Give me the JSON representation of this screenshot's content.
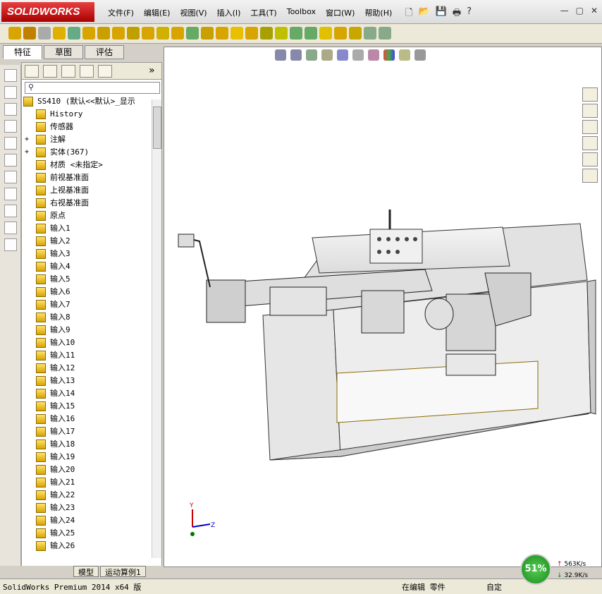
{
  "app": {
    "logo": "SOLIDWORKS"
  },
  "menu": [
    "文件(F)",
    "编辑(E)",
    "视图(V)",
    "插入(I)",
    "工具(T)",
    "Toolbox",
    "窗口(W)",
    "帮助(H)"
  ],
  "fm_tabs": [
    "特征",
    "草图",
    "评估"
  ],
  "tree": {
    "root": "SS410  (默认<<默认>_显示",
    "items": [
      "History",
      "传感器",
      "注解",
      "实体(367)",
      "材质 <未指定>",
      "前视基准面",
      "上视基准面",
      "右视基准面",
      "原点"
    ],
    "inputs": [
      "输入1",
      "输入2",
      "输入3",
      "输入4",
      "输入5",
      "输入6",
      "输入7",
      "输入8",
      "输入9",
      "输入10",
      "输入11",
      "输入12",
      "输入13",
      "输入14",
      "输入15",
      "输入16",
      "输入17",
      "输入18",
      "输入19",
      "输入20",
      "输入21",
      "输入22",
      "输入23",
      "输入24",
      "输入25",
      "输入26"
    ]
  },
  "bottom_tabs": [
    "模型",
    "运动算例1"
  ],
  "status": {
    "left": "SolidWorks Premium 2014 x64 版",
    "mode": "在编辑 零件",
    "custom": "自定"
  },
  "speed": {
    "percent": "51%",
    "up": "563K/s",
    "down": "32.9K/s"
  },
  "axes": {
    "x": "Z",
    "y": "Y"
  }
}
